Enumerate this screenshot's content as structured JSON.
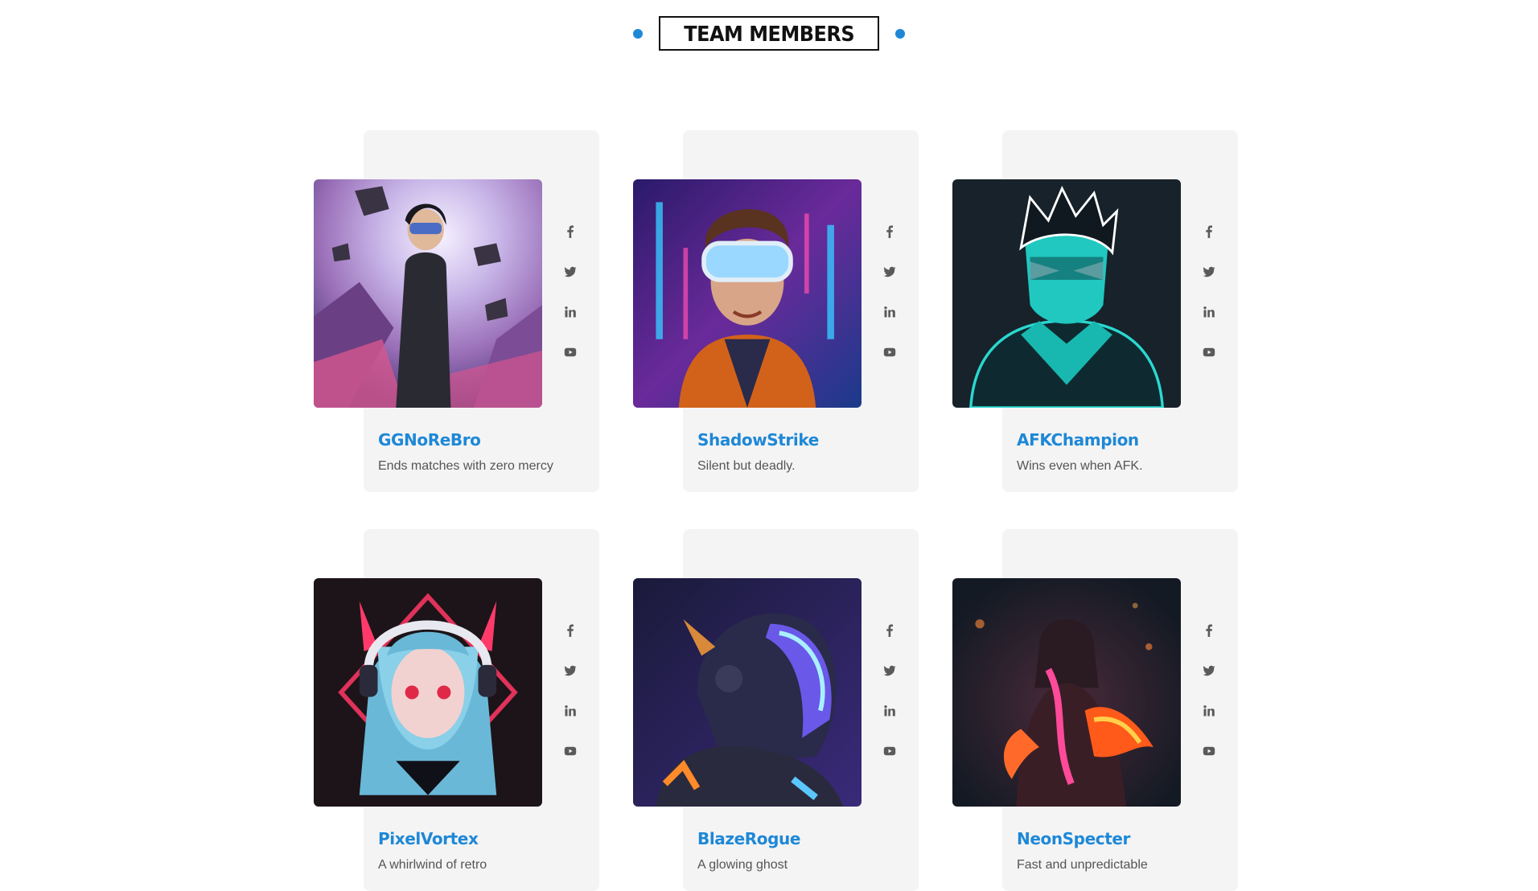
{
  "section": {
    "title": "TEAM MEMBERS",
    "accent_color": "#1e88d6"
  },
  "members": [
    {
      "name": "GGNoReBro",
      "bio": "Ends matches with zero mercy",
      "avatar": "vr-gamer-pink-asteroids-art"
    },
    {
      "name": "ShadowStrike",
      "bio": "Silent but deadly.",
      "avatar": "goggles-neon-boy-art"
    },
    {
      "name": "AFKChampion",
      "bio": "Wins even when AFK.",
      "avatar": "cyan-masked-ninja-art"
    },
    {
      "name": "PixelVortex",
      "bio": "A whirlwind of retro",
      "avatar": "anime-girl-headphones-art"
    },
    {
      "name": "BlazeRogue",
      "bio": "A glowing ghost",
      "avatar": "neon-helmet-warrior-art"
    },
    {
      "name": "NeonSpecter",
      "bio": "Fast and unpredictable",
      "avatar": "fire-hooded-figure-art"
    }
  ],
  "social_icons": [
    "facebook-icon",
    "twitter-icon",
    "linkedin-icon",
    "youtube-icon"
  ]
}
